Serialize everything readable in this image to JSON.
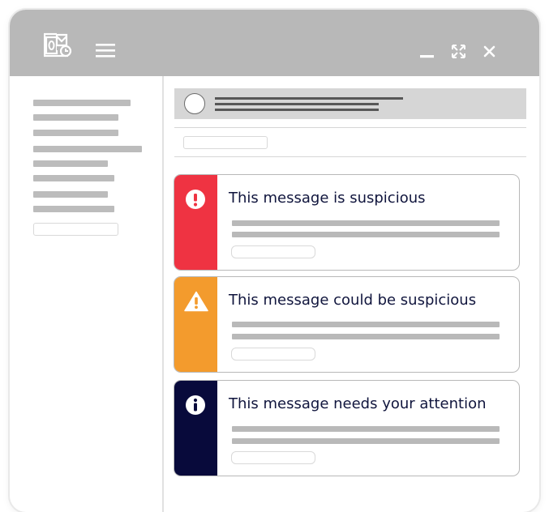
{
  "app": {
    "icon": "outlook-icon",
    "menu_icon": "hamburger-menu-icon",
    "window_controls": [
      "minimize-icon",
      "maximize-icon",
      "close-icon"
    ],
    "colors": {
      "titlebar": "#b8b8b8",
      "accent_text": "#10153d"
    }
  },
  "alerts": [
    {
      "title": "This message is suspicious",
      "severity": "high",
      "icon": "exclamation-circle-icon",
      "color": "#ef3342"
    },
    {
      "title": "This message could be suspicious",
      "severity": "medium",
      "icon": "warning-triangle-icon",
      "color": "#f39b2d"
    },
    {
      "title": "This message needs your attention",
      "severity": "info",
      "icon": "info-circle-icon",
      "color": "#080a3b"
    }
  ]
}
